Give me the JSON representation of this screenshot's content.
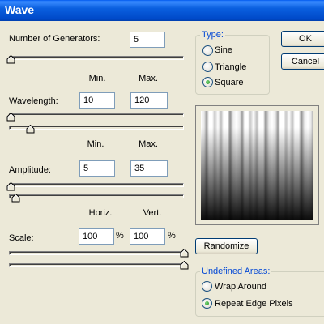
{
  "title": "Wave",
  "generators": {
    "label": "Number of Generators:",
    "value": "5",
    "slider_fraction": 0.0
  },
  "wavelength": {
    "label": "Wavelength:",
    "min_header": "Min.",
    "max_header": "Max.",
    "min": "10",
    "max": "120"
  },
  "amplitude": {
    "label": "Amplitude:",
    "min_header": "Min.",
    "max_header": "Max.",
    "min": "5",
    "max": "35"
  },
  "scale": {
    "label": "Scale:",
    "horiz_header": "Horiz.",
    "vert_header": "Vert.",
    "horiz": "100",
    "vert": "100",
    "unit": "%"
  },
  "type": {
    "title": "Type:",
    "options": [
      {
        "label": "Sine",
        "selected": false
      },
      {
        "label": "Triangle",
        "selected": false
      },
      {
        "label": "Square",
        "selected": true
      }
    ]
  },
  "buttons": {
    "ok": "OK",
    "cancel": "Cancel",
    "randomize": "Randomize"
  },
  "undefined_areas": {
    "title": "Undefined Areas:",
    "options": [
      {
        "label": "Wrap Around",
        "selected": false
      },
      {
        "label": "Repeat Edge Pixels",
        "selected": true
      }
    ]
  },
  "colors": {
    "title_bar": "#0055e5",
    "group_title": "#0046d5",
    "dialog_bg": "#ece9d8"
  }
}
